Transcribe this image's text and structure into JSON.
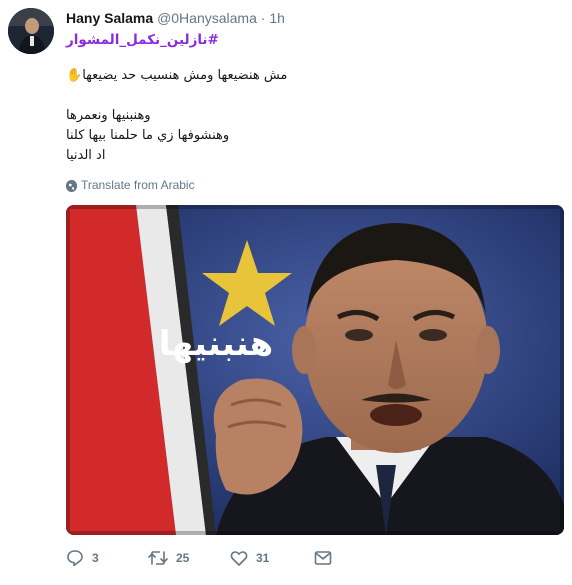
{
  "tweet": {
    "name": "Hany Salama",
    "handle": "@0Hanysalama",
    "separator": "·",
    "time": "1h",
    "hashtag": "#نازلين_نكمل_المشوار",
    "line1": "مش هنضيعها ومش هنسيب حد يضيعها",
    "wave_emoji": "✋",
    "line2": "وهنبنيها ونعمرها",
    "line3": "وهنشوفها زي ما حلمنا بيها كلنا",
    "line4": "اد الدنيا",
    "translate_label": "Translate from Arabic"
  },
  "media": {
    "overlay_text": "هنبنيها"
  },
  "actions": {
    "reply_count": "3",
    "retweet_count": "25",
    "like_count": "31"
  }
}
